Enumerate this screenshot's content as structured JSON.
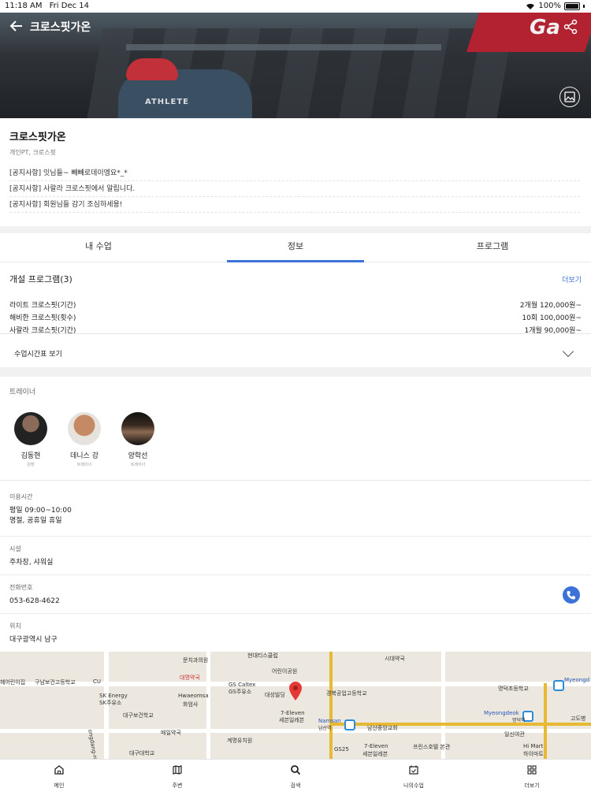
{
  "status_bar": {
    "time": "11:18 AM",
    "date": "Fri Dec 14",
    "battery": "100%"
  },
  "header": {
    "title": "크로스핏가온",
    "hero_shirt_text": "ATHLETE",
    "hero_sign_text": "Ga"
  },
  "studio": {
    "name": "크로스핏가온",
    "subtitle": "개인PT, 크로스핏"
  },
  "notices": [
    "[공지사항] 잇님들~ 빼빼로데이엥요*_*",
    "[공지사항] 사랄라 크로스핏에서 알립니다.",
    "[공지사항] 회원님들 감기 조심하세용!"
  ],
  "tabs": [
    {
      "label": "내 수업"
    },
    {
      "label": "정보"
    },
    {
      "label": "프로그램"
    }
  ],
  "programs": {
    "title": "개설 프로그램(3)",
    "more_label": "더보기",
    "items": [
      {
        "name": "라이트 크로스핏(기간)",
        "price": "2개월 120,000원~"
      },
      {
        "name": "해비한 크로스핏(횟수)",
        "price": "10회 100,000원~"
      },
      {
        "name": "사랄라 크로스핏(기간)",
        "price": "1개월 90,000원~"
      }
    ]
  },
  "schedule": {
    "label": "수업시간표 보기"
  },
  "trainers": {
    "label": "트레이너",
    "items": [
      {
        "name": "김동현",
        "role": "원장"
      },
      {
        "name": "데니스 강",
        "role": "트레이너"
      },
      {
        "name": "양학선",
        "role": "트레이너"
      }
    ]
  },
  "info": {
    "hours": {
      "label": "이용시간",
      "line1": "평일 09:00~10:00",
      "line2": "명절, 공휴일 휴일"
    },
    "facilities": {
      "label": "시설",
      "value": "주차장, 샤워실"
    },
    "phone": {
      "label": "전화번호",
      "value": "053-628-4622"
    },
    "location": {
      "label": "위치",
      "value": "대구광역시 남구"
    }
  },
  "map": {
    "labels": {
      "a": "문치과의원",
      "b": "현대티스클럽",
      "c": "시대약국",
      "d": "어린이공원",
      "e": "대명약국",
      "f": "GS Caltex",
      "g": "GS주유소",
      "h": "대성빌딩",
      "i": "경북공업고등학교",
      "j": "7-Eleven",
      "k": "세븐일레븐",
      "l": "구남보건고등학교",
      "m": "SK Energy",
      "n": "SK주유소",
      "o": "Hwaeomsa",
      "p": "화엄사",
      "q": "대구보건학교",
      "r": "매일약국",
      "s": "계명유치원",
      "t": "대구대학교",
      "u": "Namsan",
      "v": "남산역",
      "w": "남산중앙교회",
      "x": "7-Eleven",
      "y": "세븐일레븐",
      "z": "프린스호텔 본관",
      "aa": "Myeongdeok",
      "bb": "명덕역",
      "cc": "Myeongd",
      "dd": "명덕초등학교",
      "ee": "일신여관",
      "ff": "Hi Mart",
      "gg": "하이마트",
      "hh": "고도병",
      "ii": "GS25",
      "jj": "혜어린이집",
      "kk": "CU",
      "ll": "ongdang-ro"
    }
  },
  "bottom_nav": [
    {
      "label": "메인"
    },
    {
      "label": "주변"
    },
    {
      "label": "검색"
    },
    {
      "label": "나의수업"
    },
    {
      "label": "더보기"
    }
  ]
}
